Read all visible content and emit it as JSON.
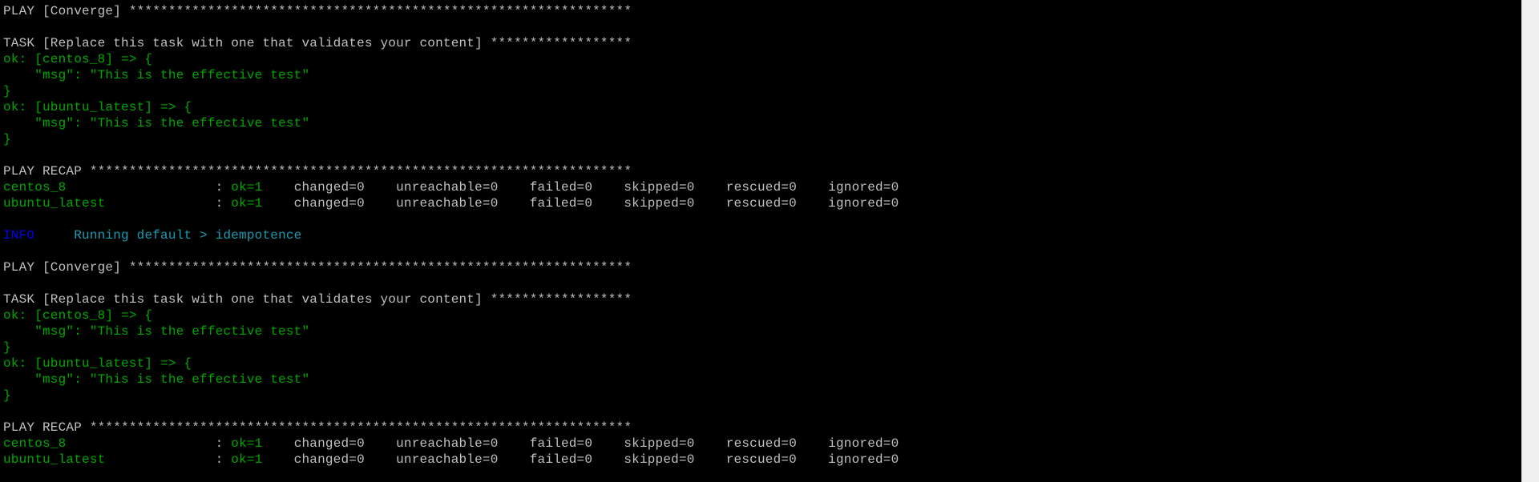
{
  "terminal": {
    "colors": {
      "background": "#000000",
      "default": "#c0c0c0",
      "ok": "#00a600",
      "info": "#0000ee",
      "info_msg": "#1a9cb0"
    },
    "lines": [
      [
        {
          "t": "PLAY [Converge] ****************************************************************",
          "c": "w"
        }
      ],
      [],
      [
        {
          "t": "TASK [Replace this task with one that validates your content] ******************",
          "c": "w"
        }
      ],
      [
        {
          "t": "ok: [centos_8] => {",
          "c": "g"
        }
      ],
      [
        {
          "t": "    \"msg\": \"This is the effective test\"",
          "c": "g"
        }
      ],
      [
        {
          "t": "}",
          "c": "g"
        }
      ],
      [
        {
          "t": "ok: [ubuntu_latest] => {",
          "c": "g"
        }
      ],
      [
        {
          "t": "    \"msg\": \"This is the effective test\"",
          "c": "g"
        }
      ],
      [
        {
          "t": "}",
          "c": "g"
        }
      ],
      [],
      [
        {
          "t": "PLAY RECAP *********************************************************************",
          "c": "w"
        }
      ],
      [
        {
          "t": "centos_8",
          "c": "g"
        },
        {
          "t": "                   : ",
          "c": "w"
        },
        {
          "t": "ok=1",
          "c": "g"
        },
        {
          "t": "    changed=0    unreachable=0    failed=0    skipped=0    rescued=0    ignored=0",
          "c": "w"
        }
      ],
      [
        {
          "t": "ubuntu_latest",
          "c": "g"
        },
        {
          "t": "              : ",
          "c": "w"
        },
        {
          "t": "ok=1",
          "c": "g"
        },
        {
          "t": "    changed=0    unreachable=0    failed=0    skipped=0    rescued=0    ignored=0",
          "c": "w"
        }
      ],
      [],
      [
        {
          "t": "INFO",
          "c": "b"
        },
        {
          "t": "     Running default > idempotence",
          "c": "c"
        }
      ],
      [],
      [
        {
          "t": "PLAY [Converge] ****************************************************************",
          "c": "w"
        }
      ],
      [],
      [
        {
          "t": "TASK [Replace this task with one that validates your content] ******************",
          "c": "w"
        }
      ],
      [
        {
          "t": "ok: [centos_8] => {",
          "c": "g"
        }
      ],
      [
        {
          "t": "    \"msg\": \"This is the effective test\"",
          "c": "g"
        }
      ],
      [
        {
          "t": "}",
          "c": "g"
        }
      ],
      [
        {
          "t": "ok: [ubuntu_latest] => {",
          "c": "g"
        }
      ],
      [
        {
          "t": "    \"msg\": \"This is the effective test\"",
          "c": "g"
        }
      ],
      [
        {
          "t": "}",
          "c": "g"
        }
      ],
      [],
      [
        {
          "t": "PLAY RECAP *********************************************************************",
          "c": "w"
        }
      ],
      [
        {
          "t": "centos_8",
          "c": "g"
        },
        {
          "t": "                   : ",
          "c": "w"
        },
        {
          "t": "ok=1",
          "c": "g"
        },
        {
          "t": "    changed=0    unreachable=0    failed=0    skipped=0    rescued=0    ignored=0",
          "c": "w"
        }
      ],
      [
        {
          "t": "ubuntu_latest",
          "c": "g"
        },
        {
          "t": "              : ",
          "c": "w"
        },
        {
          "t": "ok=1",
          "c": "g"
        },
        {
          "t": "    changed=0    unreachable=0    failed=0    skipped=0    rescued=0    ignored=0",
          "c": "w"
        }
      ]
    ]
  }
}
